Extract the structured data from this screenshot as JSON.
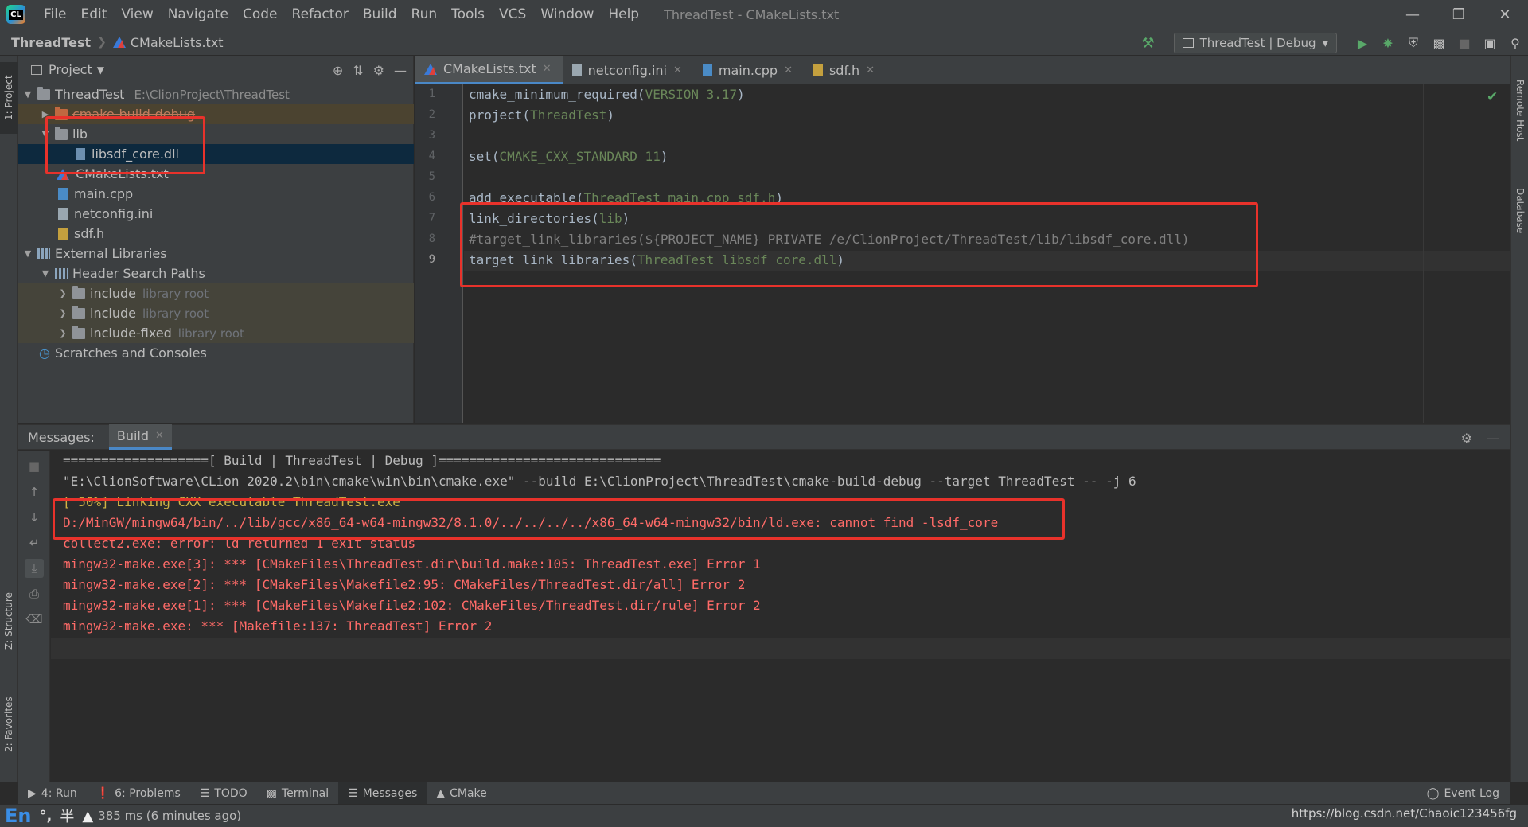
{
  "app": {
    "window_title": "ThreadTest - CMakeLists.txt",
    "menu": [
      "File",
      "Edit",
      "View",
      "Navigate",
      "Code",
      "Refactor",
      "Build",
      "Run",
      "Tools",
      "VCS",
      "Window",
      "Help"
    ]
  },
  "navbar": {
    "project": "ThreadTest",
    "file": "CMakeLists.txt",
    "run_config": "ThreadTest | Debug"
  },
  "left_stripe": {
    "project_tab": "1: Project",
    "structure_tab": "Z: Structure",
    "favorites_tab": "2: Favorites"
  },
  "right_stripe": {
    "remote_host": "Remote Host",
    "database": "Database"
  },
  "project_panel": {
    "title": "Project",
    "tree": {
      "root": {
        "label": "ThreadTest",
        "path": "E:\\ClionProject\\ThreadTest"
      },
      "cmake_build": "cmake-build-debug",
      "lib": "lib",
      "dll": "libsdf_core.dll",
      "cmakelists": "CMakeLists.txt",
      "main": "main.cpp",
      "netconfig": "netconfig.ini",
      "sdfh": "sdf.h",
      "ext_libs": "External Libraries",
      "header_paths": "Header Search Paths",
      "include1": "include",
      "include2": "include",
      "include_fixed": "include-fixed",
      "lib_root_hint": "library root",
      "scratches": "Scratches and Consoles"
    }
  },
  "editor": {
    "tabs": [
      "CMakeLists.txt",
      "netconfig.ini",
      "main.cpp",
      "sdf.h"
    ],
    "line_numbers": [
      "1",
      "2",
      "3",
      "4",
      "5",
      "6",
      "7",
      "8",
      "9"
    ],
    "lines": {
      "l1_fn": "cmake_minimum_required(",
      "l1_arg": "VERSION 3.17",
      "l1_end": ")",
      "l2_fn": "project(",
      "l2_arg": "ThreadTest",
      "l2_end": ")",
      "l4_fn": "set(",
      "l4_arg": "CMAKE_CXX_STANDARD 11",
      "l4_end": ")",
      "l6_fn": "add_executable(",
      "l6_arg": "ThreadTest main.cpp sdf.h",
      "l6_end": ")",
      "l7_fn": "link_directories(",
      "l7_arg": "lib",
      "l7_end": ")",
      "l8_cmt": "#target_link_libraries(${PROJECT_NAME} PRIVATE /e/ClionProject/ThreadTest/lib/libsdf_core.dll)",
      "l9_fn": "target_link_libraries(",
      "l9_arg": "ThreadTest libsdf_core.dll",
      "l9_end": ")"
    }
  },
  "messages": {
    "label": "Messages:",
    "tab": "Build",
    "output": [
      "===================[ Build | ThreadTest | Debug ]=============================",
      "\"E:\\ClionSoftware\\CLion 2020.2\\bin\\cmake\\win\\bin\\cmake.exe\" --build E:\\ClionProject\\ThreadTest\\cmake-build-debug --target ThreadTest -- -j 6",
      "[ 50%] Linking CXX executable ThreadTest.exe",
      "D:/MinGW/mingw64/bin/../lib/gcc/x86_64-w64-mingw32/8.1.0/../../../../x86_64-w64-mingw32/bin/ld.exe: cannot find -lsdf_core",
      "collect2.exe: error: ld returned 1 exit status",
      "mingw32-make.exe[3]: *** [CMakeFiles\\ThreadTest.dir\\build.make:105: ThreadTest.exe] Error 1",
      "mingw32-make.exe[2]: *** [CMakeFiles\\Makefile2:95: CMakeFiles/ThreadTest.dir/all] Error 2",
      "mingw32-make.exe[1]: *** [CMakeFiles\\Makefile2:102: CMakeFiles/ThreadTest.dir/rule] Error 2",
      "mingw32-make.exe: *** [Makefile:137: ThreadTest] Error 2"
    ]
  },
  "bottom_bar": {
    "tabs": [
      "4: Run",
      "6: Problems",
      "TODO",
      "Terminal",
      "Messages",
      "CMake"
    ],
    "event_log": "Event Log"
  },
  "status": {
    "ime_lang": "En",
    "ime_punct": "°,",
    "ime_half": "半",
    "text": "385 ms (6 minutes ago)",
    "watermark": "https://blog.csdn.net/Chaoic123456fg"
  },
  "colors": {
    "accent": "#4a88c7",
    "error": "#ff6b68",
    "warning": "#d0b344",
    "annotation": "#e8322b"
  }
}
